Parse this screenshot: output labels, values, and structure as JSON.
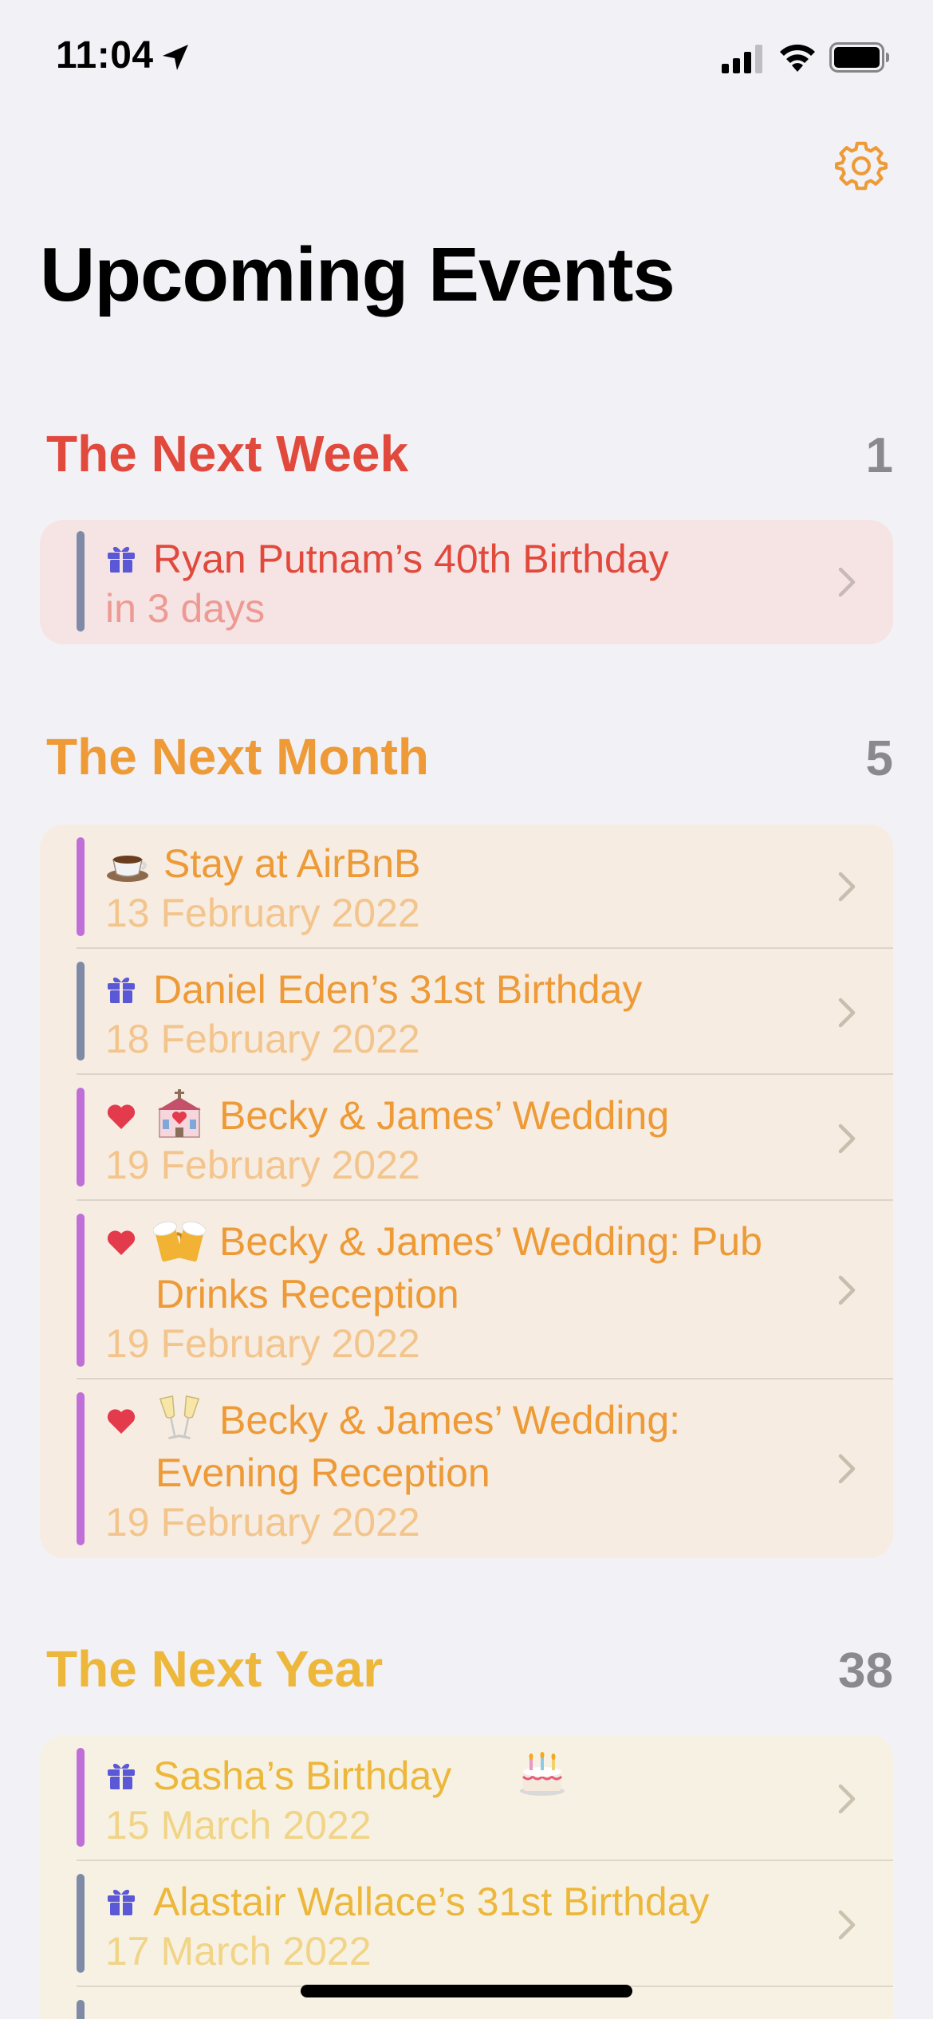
{
  "status": {
    "time": "11:04"
  },
  "page": {
    "title": "Upcoming Events"
  },
  "colors": {
    "week": "#E1493C",
    "month": "#ED9A37",
    "year": "#EDB73B",
    "bar_gray": "#7E8AA6",
    "bar_purple": "#C06FD9",
    "gift": "#5B58D6",
    "heart": "#E33A4C"
  },
  "sections": {
    "week": {
      "title": "The Next Week",
      "count": "1",
      "items": [
        {
          "icon": "gift-icon",
          "title": "Ryan Putnam’s 40th Birthday",
          "subtitle": "in 3 days"
        }
      ]
    },
    "month": {
      "title": "The Next Month",
      "count": "5",
      "items": [
        {
          "icon": "coffee-icon",
          "title": "Stay at AirBnB",
          "subtitle": "13 February 2022"
        },
        {
          "icon": "gift-icon",
          "title": "Daniel Eden’s 31st Birthday",
          "subtitle": "18 February 2022"
        },
        {
          "icon": "heart-icon",
          "icon2": "wedding-chapel-icon",
          "title": "Becky & James’ Wedding",
          "subtitle": "19 February 2022"
        },
        {
          "icon": "heart-icon",
          "icon2": "beer-mugs-icon",
          "title": "Becky & James’ Wedding: Pub",
          "title_line2": "Drinks Reception",
          "subtitle": "19 February 2022"
        },
        {
          "icon": "heart-icon",
          "icon2": "champagne-glasses-icon",
          "title": "Becky & James’ Wedding:",
          "title_line2": "Evening Reception",
          "subtitle": "19 February 2022"
        }
      ]
    },
    "year": {
      "title": "The Next Year",
      "count": "38",
      "items": [
        {
          "icon": "gift-icon",
          "title": "Sasha’s Birthday",
          "title_icon": "birthday-cake-icon",
          "subtitle": "15 March 2022"
        },
        {
          "icon": "gift-icon",
          "title": "Alastair Wallace’s 31st Birthday",
          "subtitle": "17 March 2022"
        }
      ]
    }
  }
}
